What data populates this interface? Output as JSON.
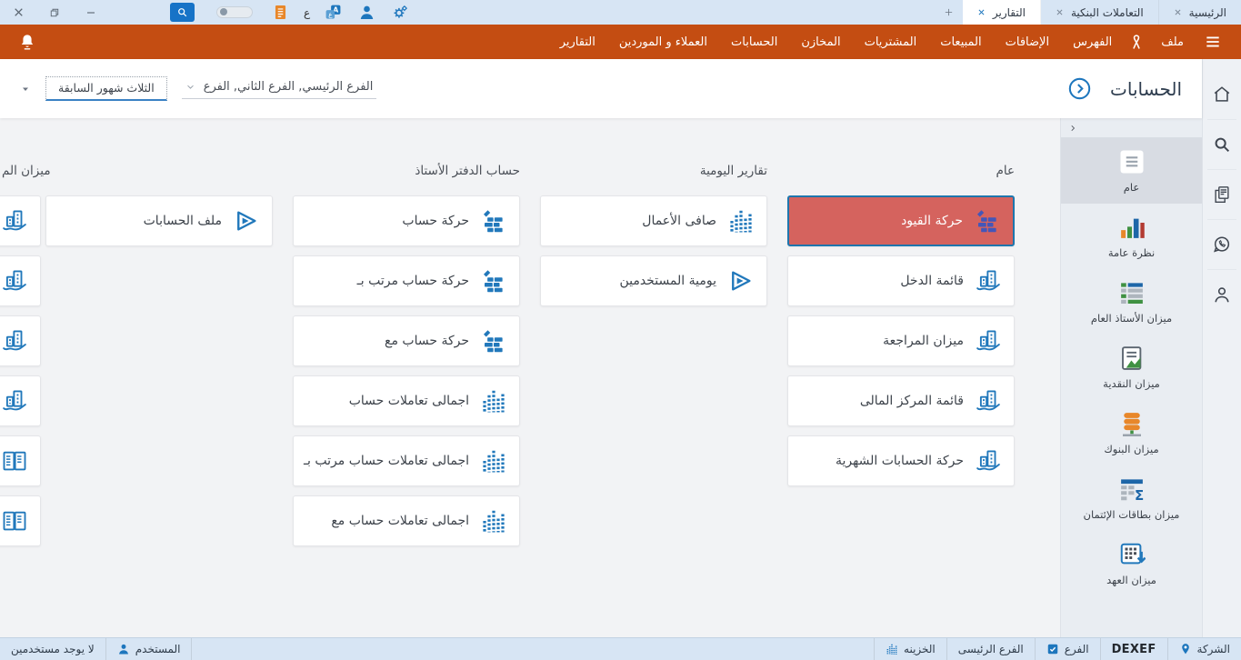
{
  "colors": {
    "accent_orange": "#c44d12",
    "titlebar_bg": "#d7e5f4",
    "statusbar_bg": "#d7e5f4",
    "page_bg": "#f2f3f5",
    "header_bg": "#ffffff",
    "sidebar_bg": "#e9edf2",
    "sidebar_selected_bg": "#d8dce3",
    "rail_bg": "#eef1f5",
    "card_bg": "#ffffff",
    "card_selected_bg": "#d5635e",
    "card_selected_border": "#1e76ad",
    "icon_blue": "#2178bb",
    "text_dark": "#3c424a"
  },
  "titlebar": {
    "tabs": [
      {
        "label": "الرئيسية",
        "active": false
      },
      {
        "label": "التعاملات البنكية",
        "active": false
      },
      {
        "label": "التقارير",
        "active": true
      }
    ],
    "new_tab_label": "+",
    "language_letter": "ع"
  },
  "menubar": {
    "items": [
      "ملف",
      "الفهرس",
      "الإضافات",
      "المبيعات",
      "المشتريات",
      "المخازن",
      "الحسابات",
      "العملاء و الموردين",
      "التقارير"
    ]
  },
  "header": {
    "title": "الحسابات",
    "branch_filter": "الفرع الرئيسي, الفرع الثاني, الفرع",
    "period_filter": "الثلاث شهور السابقة"
  },
  "sidebar": {
    "items": [
      {
        "label": "عام",
        "icon": "document-icon",
        "selected": true
      },
      {
        "label": "نظرة عامة",
        "icon": "bar-chart-icon",
        "selected": false
      },
      {
        "label": "ميزان الأستاذ العام",
        "icon": "ledger-table-icon",
        "selected": false
      },
      {
        "label": "ميزان النقدية",
        "icon": "cash-report-icon",
        "selected": false
      },
      {
        "label": "ميزان البنوك",
        "icon": "database-icon",
        "selected": false
      },
      {
        "label": "ميزان بطاقات الإئتمان",
        "icon": "table-sigma-icon",
        "selected": false
      },
      {
        "label": "ميزان العهد",
        "icon": "grid-export-icon",
        "selected": false
      }
    ]
  },
  "main": {
    "columns": [
      {
        "header": "عام",
        "cards": [
          {
            "label": "حركة القيود",
            "icon": "bricks-pen-icon",
            "selected": true
          },
          {
            "label": "قائمة الدخل",
            "icon": "buildings-icon",
            "selected": false
          },
          {
            "label": "ميزان المراجعة",
            "icon": "buildings-icon",
            "selected": false
          },
          {
            "label": "قائمة المركز المالى",
            "icon": "buildings-icon",
            "selected": false
          },
          {
            "label": "حركة الحسابات الشهرية",
            "icon": "buildings-icon",
            "selected": false
          }
        ]
      },
      {
        "header": "تقارير اليومية",
        "cards": [
          {
            "label": "صافى الأعمال",
            "icon": "equalizer-icon",
            "selected": false
          },
          {
            "label": "يومية المستخدمين",
            "icon": "play-icon",
            "selected": false
          }
        ]
      },
      {
        "header": "حساب الدفتر الأستاذ",
        "cards": [
          {
            "label": "حركة حساب",
            "icon": "bricks-pen-icon",
            "selected": false
          },
          {
            "label": "حركة حساب مرتب بـ",
            "icon": "bricks-pen-icon",
            "selected": false
          },
          {
            "label": "حركة حساب مع",
            "icon": "bricks-pen-icon",
            "selected": false
          },
          {
            "label": "اجمالى تعاملات حساب",
            "icon": "equalizer-icon",
            "selected": false
          },
          {
            "label": "اجمالى تعاملات حساب مرتب بـ",
            "icon": "equalizer-icon",
            "selected": false
          },
          {
            "label": "اجمالى تعاملات حساب مع",
            "icon": "equalizer-icon",
            "selected": false
          }
        ]
      },
      {
        "header": "",
        "cards": [
          {
            "label": "ملف الحسابات",
            "icon": "play-icon",
            "selected": false
          }
        ]
      }
    ],
    "edge_column": {
      "header": "ميزان الم",
      "cards": [
        {
          "icon": "buildings-icon"
        },
        {
          "icon": "buildings-icon"
        },
        {
          "icon": "buildings-icon"
        },
        {
          "icon": "buildings-icon"
        },
        {
          "icon": "open-book-icon"
        },
        {
          "icon": "open-book-icon"
        }
      ]
    }
  },
  "statusbar": {
    "company_label": "الشركة",
    "company_name": "DEXEF",
    "branch_label": "الفرع",
    "branch_name": "الفرع الرئيسى",
    "treasury_label": "الخزينه",
    "user_label": "المستخدم",
    "users_status": "لا يوجد مستخدمين"
  }
}
